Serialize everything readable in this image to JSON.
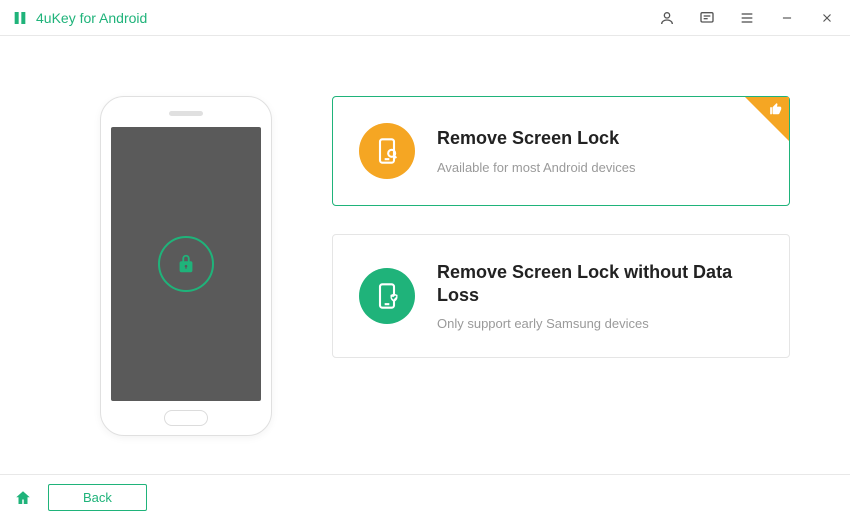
{
  "app": {
    "title": "4uKey for Android"
  },
  "options": {
    "primary": {
      "title": "Remove Screen Lock",
      "subtitle": "Available for most Android devices"
    },
    "secondary": {
      "title": "Remove Screen Lock without Data Loss",
      "subtitle": "Only support early Samsung devices"
    }
  },
  "footer": {
    "back_label": "Back"
  }
}
